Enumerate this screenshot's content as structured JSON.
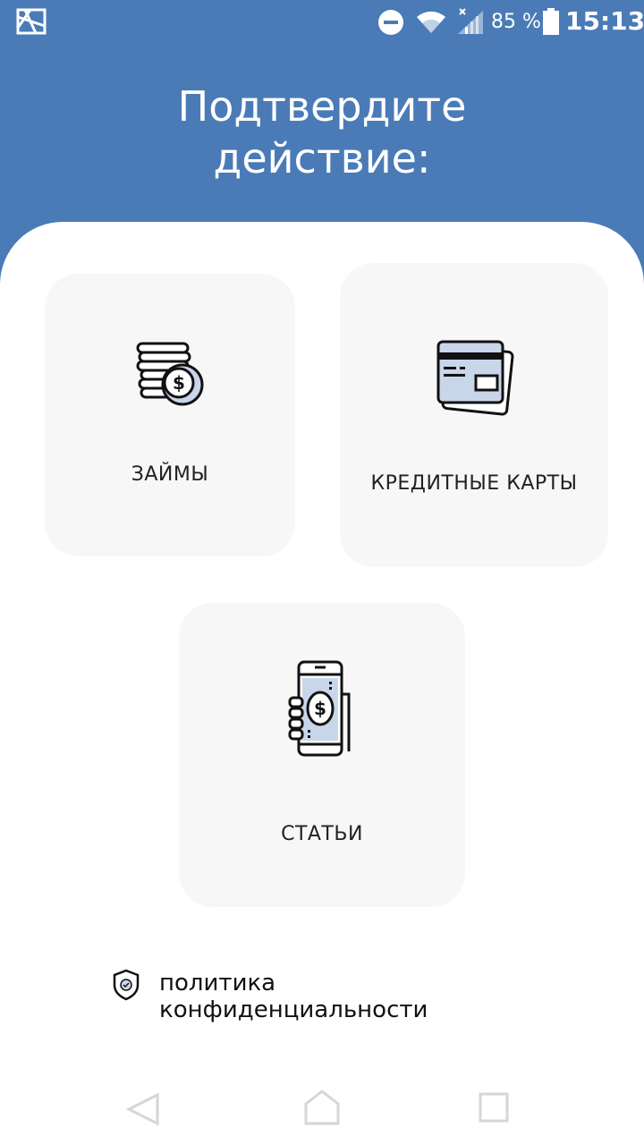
{
  "status_bar": {
    "battery": "85 %",
    "time": "15:13",
    "icons": [
      "app-icon",
      "do-not-disturb-icon",
      "wifi-icon",
      "signal-icon",
      "battery-icon"
    ]
  },
  "header": {
    "title_line1": "Подтвердите",
    "title_line2": "действие:"
  },
  "cards": {
    "loans": {
      "label": "ЗАЙМЫ",
      "icon": "coins-icon"
    },
    "credit_cards": {
      "label": "КРЕДИТНЫЕ КАРТЫ",
      "icon": "credit-card-icon"
    },
    "articles": {
      "label": "СТАТЬИ",
      "icon": "phone-money-icon"
    }
  },
  "footer": {
    "privacy_label": "политика конфиденциальности",
    "icon": "shield-icon"
  },
  "nav_bar": {
    "icons": [
      "back-icon",
      "home-icon",
      "recent-apps-icon"
    ]
  },
  "colors": {
    "header_bg": "#4a7bb7",
    "card_bg": "#f7f7f7",
    "icon_accent": "#c9d6ea"
  }
}
